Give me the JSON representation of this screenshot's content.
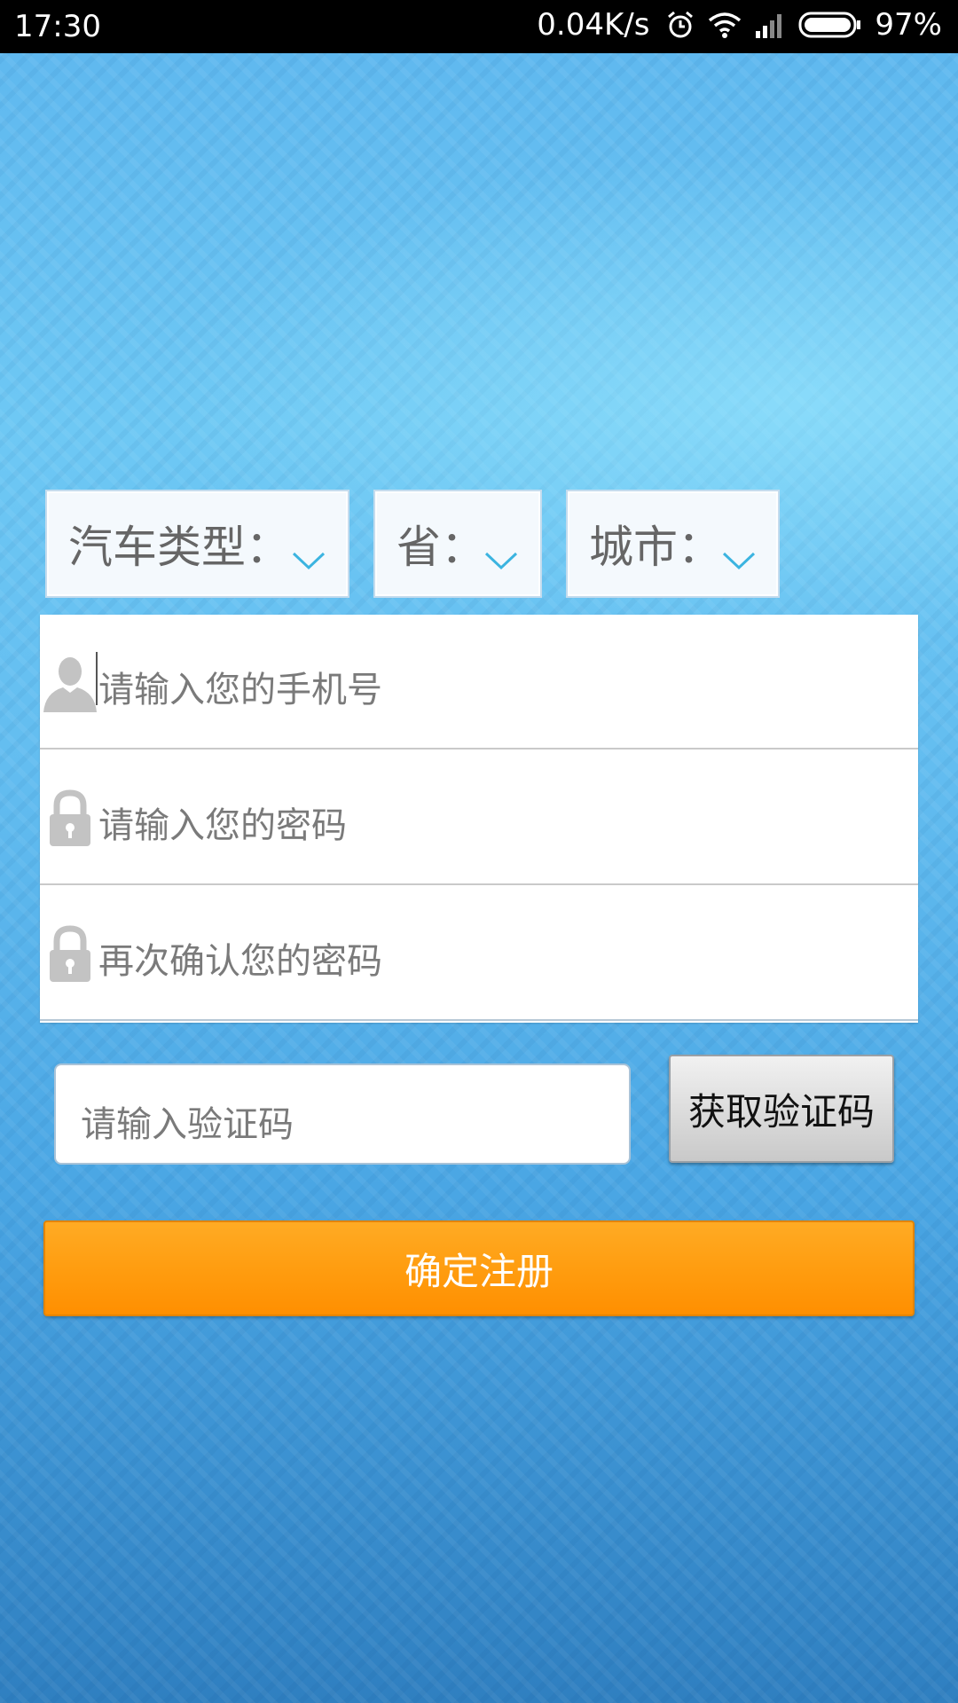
{
  "status_bar": {
    "time": "17:30",
    "network_speed": "0.04K/s",
    "battery": "97%",
    "icons": [
      "alarm-icon",
      "wifi-icon",
      "signal-icon",
      "battery-icon"
    ]
  },
  "selectors": {
    "car_type": "汽车类型：",
    "province": "省：",
    "city": "城市："
  },
  "form": {
    "phone_placeholder": "请输入您的手机号",
    "password_placeholder": "请输入您的密码",
    "confirm_password_placeholder": "再次确认您的密码",
    "code_placeholder": "请输入验证码",
    "get_code_label": "获取验证码",
    "submit_label": "确定注册"
  },
  "colors": {
    "accent_orange": "#ff9d10",
    "chevron_blue": "#3bb4e0",
    "background_blue": "#5db6ee"
  }
}
